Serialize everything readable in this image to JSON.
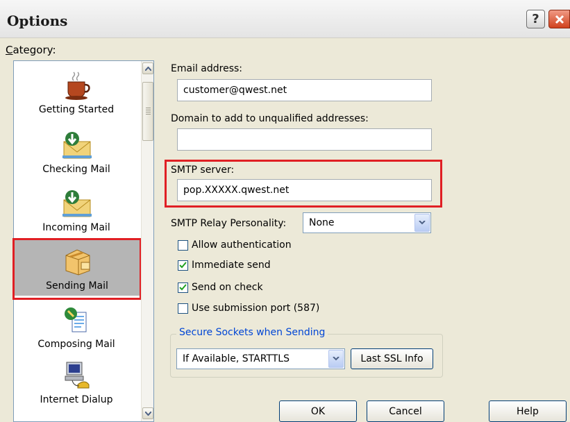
{
  "window": {
    "title": "Options",
    "help_glyph": "?",
    "close_icon": "close-icon"
  },
  "category": {
    "label": "Category:",
    "items": [
      {
        "label": "Getting Started",
        "icon": "coffee-cup-icon"
      },
      {
        "label": "Checking Mail",
        "icon": "envelope-down-arrow-icon"
      },
      {
        "label": "Incoming Mail",
        "icon": "envelope-down-arrow-icon"
      },
      {
        "label": "Sending Mail",
        "icon": "package-icon",
        "selected": true
      },
      {
        "label": "Composing Mail",
        "icon": "compose-page-icon"
      },
      {
        "label": "Internet Dialup",
        "icon": "computer-phone-icon"
      }
    ]
  },
  "form": {
    "email_label": "Email address:",
    "email_value": "customer@qwest.net",
    "domain_label": "Domain to add to unqualified addresses:",
    "domain_value": "",
    "smtp_label": "SMTP server:",
    "smtp_value": "pop.XXXXX.qwest.net",
    "relay_label": "SMTP Relay Personality:",
    "relay_value": "None",
    "checkboxes": [
      {
        "label": "Allow authentication",
        "checked": false
      },
      {
        "label": "Immediate send",
        "checked": true
      },
      {
        "label": "Send on check",
        "checked": true
      },
      {
        "label": "Use submission port (587)",
        "checked": false
      }
    ],
    "ssl_group_title": "Secure Sockets when Sending",
    "ssl_value": "If Available, STARTTLS",
    "last_ssl_button": "Last SSL Info"
  },
  "buttons": {
    "ok": "OK",
    "cancel": "Cancel",
    "help": "Help"
  },
  "colors": {
    "highlight_red": "#e01f24",
    "group_title_blue": "#0046d5",
    "dialog_bg": "#ece9d8"
  }
}
